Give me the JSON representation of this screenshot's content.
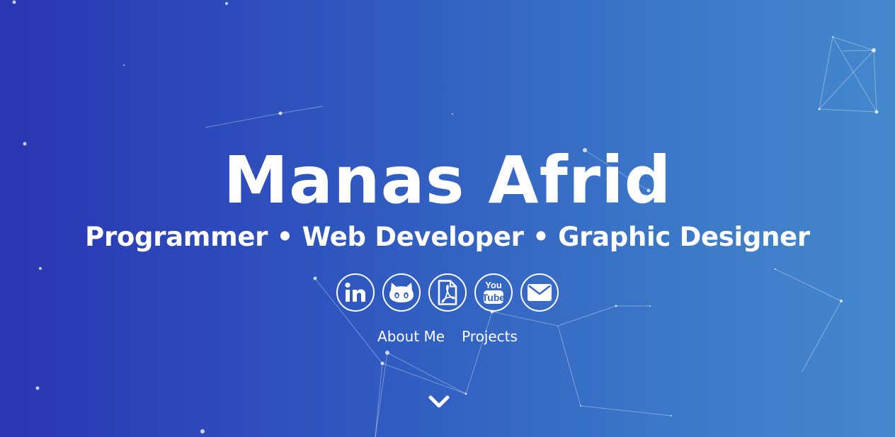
{
  "hero": {
    "name": "Manas Afrid",
    "subtitle": "Programmer • Web Developer • Graphic Designer"
  },
  "socials": [
    {
      "icon": "linkedin-icon",
      "label": "in"
    },
    {
      "icon": "github-icon"
    },
    {
      "icon": "pdf-resume-icon"
    },
    {
      "icon": "youtube-icon",
      "label_top": "You",
      "label_bottom": "Tube"
    },
    {
      "icon": "email-icon"
    }
  ],
  "nav": {
    "about": "About Me",
    "projects": "Projects"
  },
  "scroll_icon": "chevron-down-icon",
  "colors": {
    "gradient_start": "#2a35b2",
    "gradient_end": "#4488cc",
    "text": "#ffffff"
  }
}
